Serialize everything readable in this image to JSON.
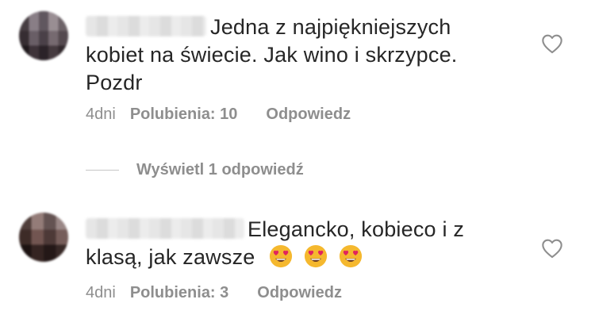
{
  "comments": [
    {
      "lines": [
        "Jedna z najpiękniejszych",
        "kobiet na świecie. Jak wino i skrzypce.",
        "Pozdr"
      ],
      "time": "4dni",
      "likes": "Polubienia: 10",
      "reply": "Odpowiedz",
      "icons": {
        "like": "heart-outline-icon"
      }
    },
    {
      "lines": [
        "Elegancko, kobieco i z",
        "klasą, jak zawsze"
      ],
      "emojis": [
        "heart-eyes-emoji",
        "heart-eyes-emoji",
        "heart-eyes-emoji"
      ],
      "time": "4dni",
      "likes": "Polubienia: 3",
      "reply": "Odpowiedz",
      "icons": {
        "like": "heart-outline-icon"
      }
    }
  ],
  "view_replies": "Wyświetl 1 odpowiedź",
  "colors": {
    "text": "#262626",
    "secondary": "#8e8e8e",
    "emoji": "#f5b82e",
    "heart_red": "#e0245e"
  }
}
